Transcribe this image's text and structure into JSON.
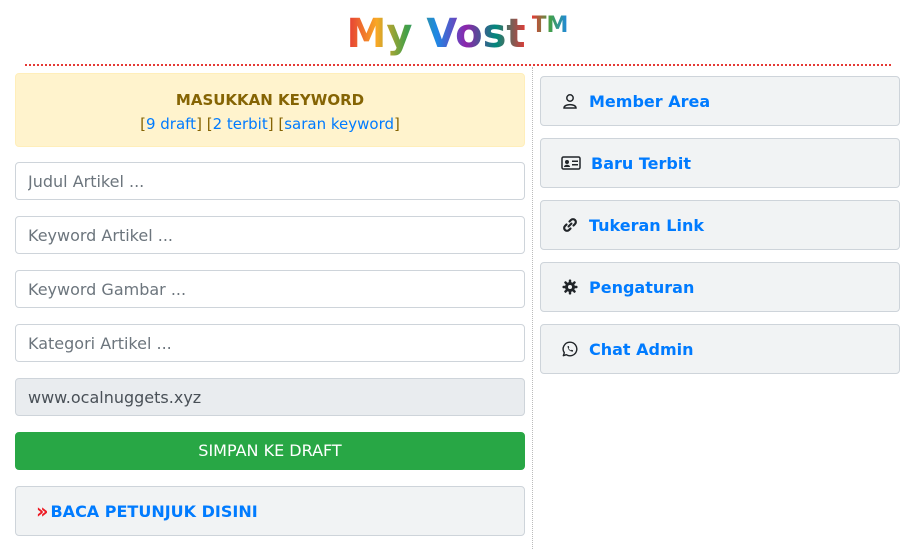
{
  "header": {
    "title": "My Vost",
    "trademark": "TM"
  },
  "keyword_panel": {
    "heading": "MASUKKAN KEYWORD",
    "draft_link": "9 draft",
    "published_link": "2 terbit",
    "suggest_link": "saran keyword",
    "bracket_open": "[",
    "bracket_close": "]"
  },
  "form": {
    "title_placeholder": "Judul Artikel ...",
    "keyword_placeholder": "Keyword Artikel ...",
    "image_keyword_placeholder": "Keyword Gambar ...",
    "category_placeholder": "Kategori Artikel ...",
    "site_value": "www.ocalnuggets.xyz",
    "save_label": "SIMPAN KE DRAFT"
  },
  "guide": {
    "label": "BACA PETUNJUK DISINI",
    "icon": "double-chevron-right-icon"
  },
  "sidebar": {
    "items": [
      {
        "label": "Member Area",
        "icon": "user-icon"
      },
      {
        "label": "Baru Terbit",
        "icon": "id-card-icon"
      },
      {
        "label": "Tukeran Link",
        "icon": "link-icon"
      },
      {
        "label": "Pengaturan",
        "icon": "gear-icon"
      },
      {
        "label": "Chat Admin",
        "icon": "whatsapp-icon"
      }
    ]
  },
  "colors": {
    "link": "#007bff",
    "save_button": "#28a745",
    "alert_bg": "#fff3cd",
    "alert_text": "#856404",
    "chevron": "#ee1b24"
  }
}
